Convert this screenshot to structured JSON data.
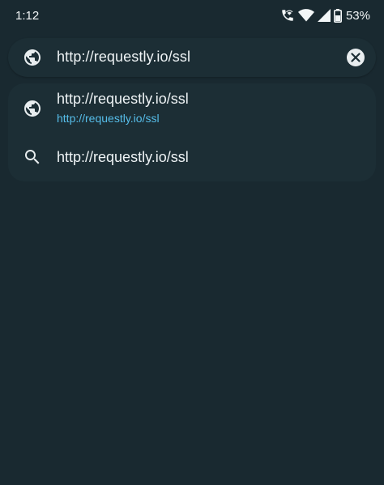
{
  "status_bar": {
    "time": "1:12",
    "battery_percent": "53%",
    "icons": [
      "wifi-calling-icon",
      "wifi-icon",
      "signal-icon",
      "battery-icon"
    ]
  },
  "omnibox": {
    "icon": "globe-icon",
    "value": "http://requestly.io/ssl",
    "clear_icon": "clear-icon"
  },
  "suggestions": [
    {
      "icon": "globe-icon",
      "title": "http://requestly.io/ssl",
      "url": "http://requestly.io/ssl"
    },
    {
      "icon": "search-icon",
      "title": "http://requestly.io/ssl"
    }
  ],
  "colors": {
    "background": "#192930",
    "card": "#1c2e35",
    "link": "#56bde9"
  }
}
